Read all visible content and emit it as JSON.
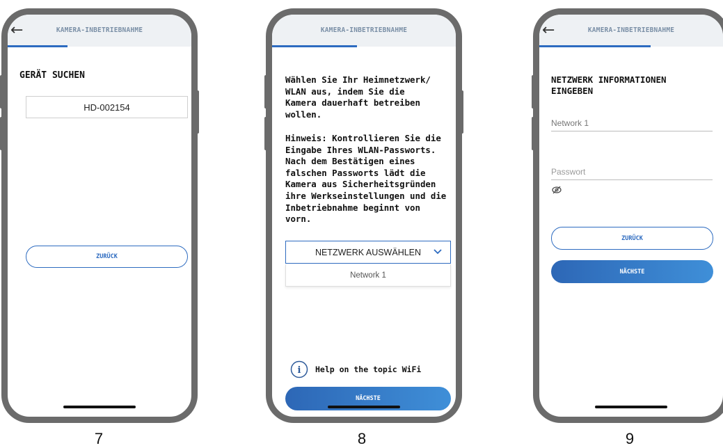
{
  "header_title": "KAMERA-INBETRIEBNAHME",
  "screen7": {
    "heading": "GERÄT SUCHEN",
    "device": "HD-002154",
    "back_button": "ZURÜCK",
    "number": "7"
  },
  "screen8": {
    "para1": "Wählen Sie Ihr Heimnetzwerk/\nWLAN aus, indem Sie die\nKamera dauerhaft betreiben\nwollen.",
    "para2": "Hinweis: Kontrollieren Sie die\nEingabe Ihres WLAN-Passworts.\nNach dem Bestätigen eines\nfalschen Passworts lädt die\nKamera aus Sicherheitsgründen\nihre Werkseinstellungen und die\nInbetriebnahme beginnt von\nvorn.",
    "select_label": "NETZWERK AUSWÄHLEN",
    "option": "Network 1",
    "help": "Help on the topic WiFi",
    "next_button": "NÄCHSTE",
    "number": "8"
  },
  "screen9": {
    "heading": "NETZWERK INFORMATIONEN\nEINGEBEN",
    "network_value": "Network 1",
    "password_placeholder": "Passwort",
    "back_button": "ZURÜCK",
    "next_button": "NÄCHSTE",
    "number": "9"
  },
  "colors": {
    "accent": "#2d6bc0",
    "frame": "#6b6b6b",
    "header_bg": "#eef1f4"
  },
  "icons": [
    "back-arrow-icon",
    "chevron-down-icon",
    "info-icon",
    "eye-hidden-icon"
  ]
}
